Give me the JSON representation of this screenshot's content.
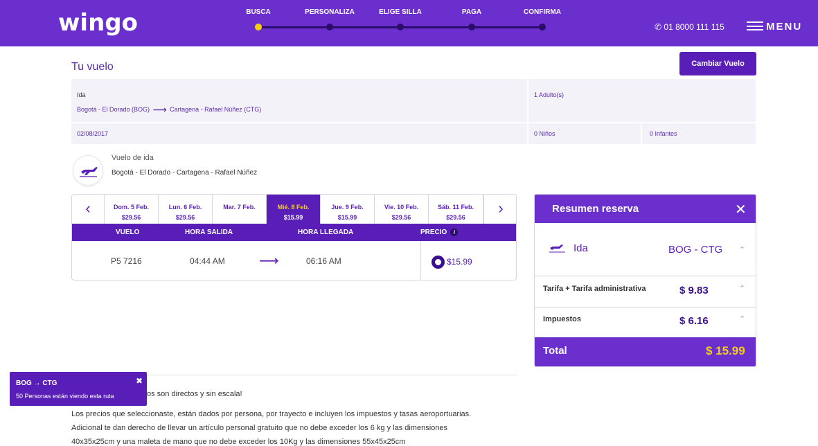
{
  "brand": {
    "logo": "wingo",
    "accent": "#6b2fce",
    "highlight": "#f5d010"
  },
  "steps": [
    {
      "label": "BUSCA",
      "active": true
    },
    {
      "label": "PERSONALIZA",
      "active": false
    },
    {
      "label": "ELIGE SILLA",
      "active": false
    },
    {
      "label": "PAGA",
      "active": false
    },
    {
      "label": "CONFIRMA",
      "active": false
    }
  ],
  "header": {
    "phone": "01 8000 111 115",
    "menu_label": "MENU"
  },
  "tu_vuelo": {
    "title": "Tu vuelo",
    "change_button": "Cambiar Vuelo",
    "ida_label": "Ida",
    "origin": "Bogotá - El Dorado (BOG)",
    "destination": "Cartagena - Rafael Núñez (CTG)",
    "date": "02/08/2017",
    "adults": "1 Adulto(s)",
    "children": "0 Niños",
    "infants": "0 Infantes"
  },
  "vuelo_ida": {
    "title": "Vuelo de ida",
    "route": "Bogotá - El Dorado - Cartagena - Rafael Núñez"
  },
  "dates": [
    {
      "label": "Dom. 5 Feb.",
      "price": "$29.56",
      "active": false
    },
    {
      "label": "Lun. 6 Feb.",
      "price": "$29.56",
      "active": false
    },
    {
      "label": "Mar. 7 Feb.",
      "price": "",
      "active": false
    },
    {
      "label": "Mié. 8 Feb.",
      "price": "$15.99",
      "active": true
    },
    {
      "label": "Jue. 9 Feb.",
      "price": "$15.99",
      "active": false
    },
    {
      "label": "Vie. 10 Feb.",
      "price": "$29.56",
      "active": false
    },
    {
      "label": "Sáb. 11 Feb.",
      "price": "$29.56",
      "active": false
    }
  ],
  "table": {
    "headers": {
      "vuelo": "VUELO",
      "salida": "HORA SALIDA",
      "llegada": "HORA LLEGADA",
      "precio": "PRECIO"
    },
    "info_icon": "i",
    "row": {
      "flight": "P5 7216",
      "departure": "04:44 AM",
      "arrival": "06:16 AM",
      "price": "$15.99"
    }
  },
  "resumen": {
    "title": "Resumen reserva",
    "ida": "Ida",
    "route": "BOG - CTG",
    "tarifa_label": "Tarifa + Tarifa administrativa",
    "tarifa_value": "$ 9.83",
    "impuestos_label": "Impuestos",
    "impuestos_value": "$ 6.16",
    "total_label": "Total",
    "total_value": "$ 15.99"
  },
  "popup": {
    "route": "BOG → CTG",
    "message": "50 Personas están viendo esta ruta"
  },
  "notes": {
    "line1": "os son directos y sin escala!",
    "line2": "Los precios que seleccionaste, están dados por persona, por trayecto e incluyen los impuestos y tasas aeroportuarias.",
    "line3": "Adicional te dan derecho de llevar un artículo personal gratuito que no debe exceder los 6 kg y las dimensiones",
    "line4": "40x35x25cm y una maleta de mano que no debe exceder los 10Kg y las dimensiones 55x45x25cm"
  }
}
